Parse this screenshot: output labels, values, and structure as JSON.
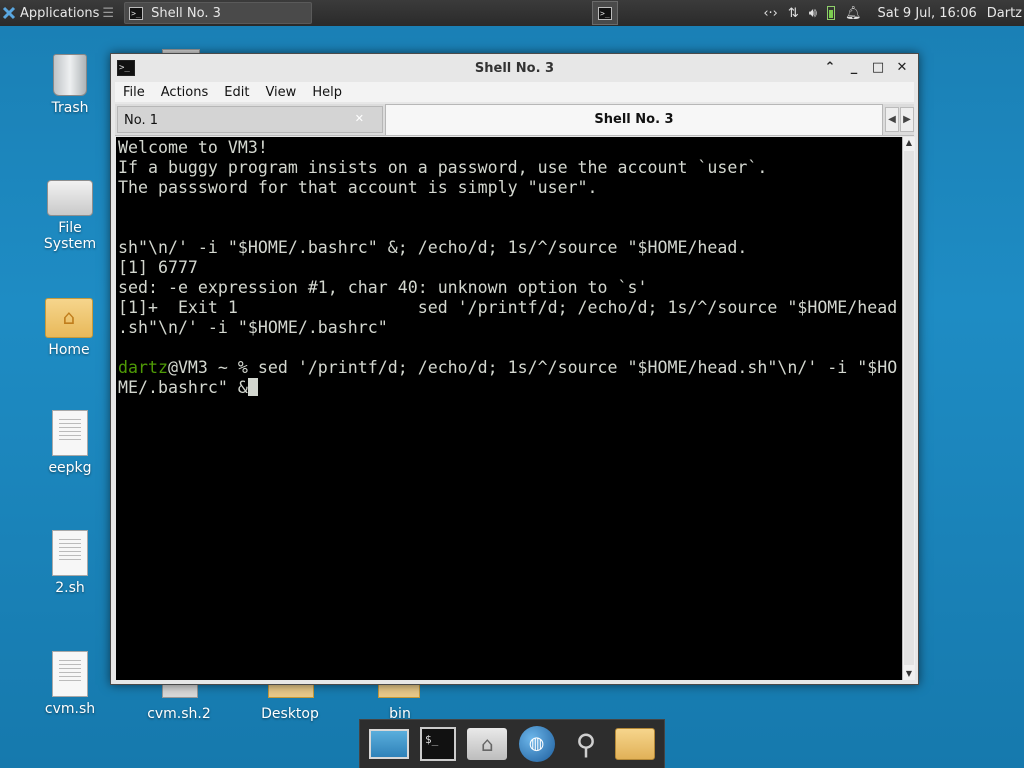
{
  "panel": {
    "apps_label": "Applications",
    "task_label": "Shell No. 3",
    "clock": "Sat  9 Jul, 16:06",
    "user": "Dartz"
  },
  "desktop": {
    "icons": [
      {
        "label": "Trash",
        "icon": "trash-icon"
      },
      {
        "label": "File System",
        "icon": "drive-icon"
      },
      {
        "label": "Home",
        "icon": "home-folder-icon"
      },
      {
        "label": "eepkg",
        "icon": "text-file-icon"
      },
      {
        "label": "2.sh",
        "icon": "text-file-icon"
      },
      {
        "label": "cvm.sh",
        "icon": "text-file-icon"
      },
      {
        "label": "cvm.sh.2",
        "icon": "text-file-icon"
      },
      {
        "label": "Desktop",
        "icon": "folder-icon"
      },
      {
        "label": "bin",
        "icon": "folder-icon"
      }
    ]
  },
  "window": {
    "title": "Shell No. 3",
    "menus": [
      "File",
      "Actions",
      "Edit",
      "View",
      "Help"
    ],
    "tabs": [
      {
        "label": "No. 1",
        "active": false
      },
      {
        "label": "Shell No. 3",
        "active": true
      }
    ]
  },
  "terminal": {
    "lines": [
      "Welcome to VM3!",
      "If a buggy program insists on a password, use the account `user`.",
      "The passsword for that account is simply \"user\".",
      "",
      "",
      "sh\"\\n/' -i \"$HOME/.bashrc\" &; /echo/d; 1s/^/source \"$HOME/head.",
      "[1] 6777",
      "sed: -e expression #1, char 40: unknown option to `s'",
      "[1]+  Exit 1                  sed '/printf/d; /echo/d; 1s/^/source \"$HOME/head",
      ".sh\"\\n/' -i \"$HOME/.bashrc\"",
      ""
    ],
    "prompt_user": "dartz",
    "prompt_rest": "@VM3 ~ % sed '/printf/d; /echo/d; 1s/^/source \"$HOME/head.sh\"\\n/' -i \"$HO",
    "prompt_cont": "ME/.bashrc\" &"
  },
  "colors": {
    "desktop_bg": "#1e8cc4",
    "terminal_bg": "#000000",
    "terminal_fg": "#d3d7cf",
    "prompt_user": "#4e9a06"
  }
}
